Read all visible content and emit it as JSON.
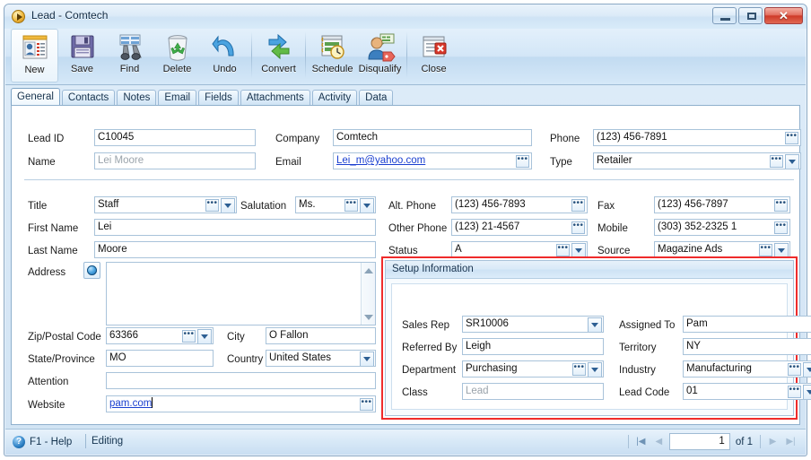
{
  "window": {
    "title": "Lead - Comtech",
    "app_icon": "play-circle-icon",
    "minimize_label": "Minimize",
    "maximize_label": "Maximize",
    "close_label": "Close"
  },
  "toolbar": {
    "buttons": [
      {
        "label": "New",
        "icon": "new-record-icon"
      },
      {
        "label": "Save",
        "icon": "floppy-disk-icon"
      },
      {
        "label": "Find",
        "icon": "binoculars-icon"
      },
      {
        "label": "Delete",
        "icon": "recycle-bin-icon"
      },
      {
        "label": "Undo",
        "icon": "undo-arrow-icon"
      },
      {
        "label": "Convert",
        "icon": "convert-arrows-icon"
      },
      {
        "label": "Schedule",
        "icon": "calendar-clock-icon"
      },
      {
        "label": "Disqualify",
        "icon": "person-tag-icon"
      },
      {
        "label": "Close",
        "icon": "document-close-icon"
      }
    ]
  },
  "tabs": [
    {
      "label": "General",
      "active": true
    },
    {
      "label": "Contacts",
      "active": false
    },
    {
      "label": "Notes",
      "active": false
    },
    {
      "label": "Email",
      "active": false
    },
    {
      "label": "Fields",
      "active": false
    },
    {
      "label": "Attachments",
      "active": false
    },
    {
      "label": "Activity",
      "active": false
    },
    {
      "label": "Data",
      "active": false
    }
  ],
  "header_fields": {
    "lead_id_label": "Lead ID",
    "lead_id_value": "C10045",
    "name_label": "Name",
    "name_value": "Lei Moore",
    "company_label": "Company",
    "company_value": "Comtech",
    "email_label": "Email",
    "email_value": "Lei_m@yahoo.com",
    "phone_label": "Phone",
    "phone_value": "(123) 456-7891",
    "type_label": "Type",
    "type_value": "Retailer"
  },
  "left_fields": {
    "title_label": "Title",
    "title_value": "Staff",
    "salutation_label": "Salutation",
    "salutation_value": "Ms.",
    "first_name_label": "First Name",
    "first_name_value": "Lei",
    "last_name_label": "Last Name",
    "last_name_value": "Moore",
    "address_label": "Address",
    "address_value": "",
    "address_globe_icon": "globe-icon",
    "zip_label": "Zip/Postal Code",
    "zip_value": "63366",
    "city_label": "City",
    "city_value": "O Fallon",
    "state_label": "State/Province",
    "state_value": "MO",
    "country_label": "Country",
    "country_value": "United States",
    "attention_label": "Attention",
    "attention_value": "",
    "website_label": "Website",
    "website_value": "pam.com"
  },
  "right_fields": {
    "alt_phone_label": "Alt. Phone",
    "alt_phone_value": "(123) 456-7893",
    "fax_label": "Fax",
    "fax_value": "(123) 456-7897",
    "other_phone_label": "Other Phone",
    "other_phone_value": "(123) 21-4567",
    "mobile_label": "Mobile",
    "mobile_value": "(303) 352-2325 1",
    "status_label": "Status",
    "status_value": "A",
    "source_label": "Source",
    "source_value": "Magazine Ads"
  },
  "setup_information": {
    "title": "Setup Information",
    "sales_rep_label": "Sales Rep",
    "sales_rep_value": "SR10006",
    "assigned_to_label": "Assigned To",
    "assigned_to_value": "Pam",
    "referred_by_label": "Referred By",
    "referred_by_value": "Leigh",
    "territory_label": "Territory",
    "territory_value": "NY",
    "department_label": "Department",
    "department_value": "Purchasing",
    "industry_label": "Industry",
    "industry_value": "Manufacturing",
    "class_label": "Class",
    "class_value": "Lead",
    "lead_code_label": "Lead Code",
    "lead_code_value": "01",
    "highlight_color": "#ef2b2b"
  },
  "statusbar": {
    "help_icon": "question-mark-icon",
    "help_label": "F1 - Help",
    "state_label": "Editing",
    "nav": {
      "first_icon": "nav-first-icon",
      "prev_icon": "nav-prev-icon",
      "page_value": "1",
      "of_label": "of 1",
      "next_icon": "nav-next-icon",
      "last_icon": "nav-last-icon"
    }
  },
  "ellipsis_glyph": "•••"
}
